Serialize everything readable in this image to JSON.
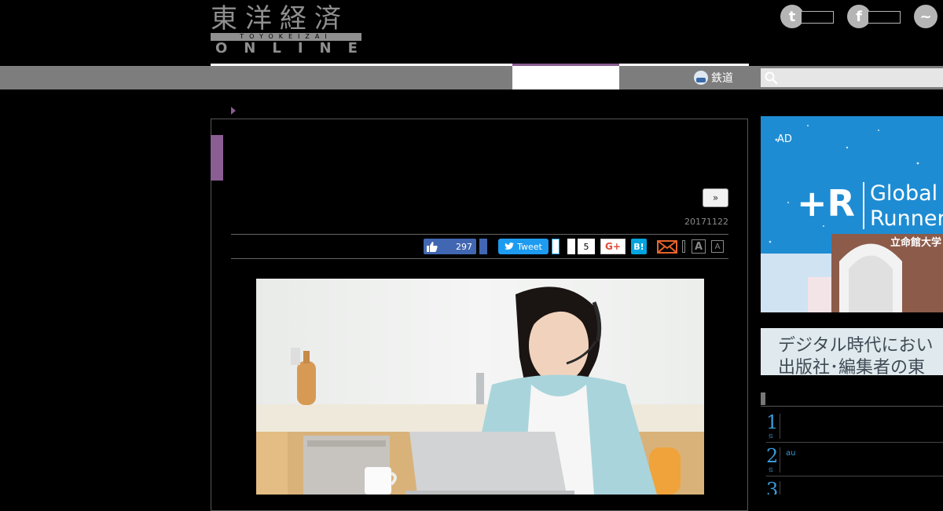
{
  "header": {
    "logo_kanji": "東洋経済",
    "logo_band": "TOYOKEIZAI",
    "logo_online": "ONLINE"
  },
  "social": [
    {
      "name": "twitter-icon",
      "glyph": "t"
    },
    {
      "name": "facebook-icon",
      "glyph": "f"
    },
    {
      "name": "messenger-icon",
      "glyph": "~"
    }
  ],
  "nav": {
    "railway_label": "鉄道",
    "search_placeholder": ""
  },
  "article": {
    "next_label": "»",
    "date": "20171122"
  },
  "share": {
    "like_count": "297",
    "tweet_label": "Tweet",
    "pocket_count": "5",
    "gplus_label": "G+",
    "hatena_label": "B!",
    "font_large": "A",
    "font_small": "A"
  },
  "ad": {
    "label": "AD",
    "mark": "+R",
    "line1": "Global",
    "line2": "Runner",
    "university": "立命館大学"
  },
  "banner2": {
    "line1": "デジタル時代におい",
    "line2": "出版社･編集者の東"
  },
  "ranking": [
    {
      "num": "1",
      "sub": "位",
      "text": ""
    },
    {
      "num": "2",
      "sub": "位",
      "text": "au"
    },
    {
      "num": "3",
      "sub": "位",
      "text": ""
    }
  ]
}
